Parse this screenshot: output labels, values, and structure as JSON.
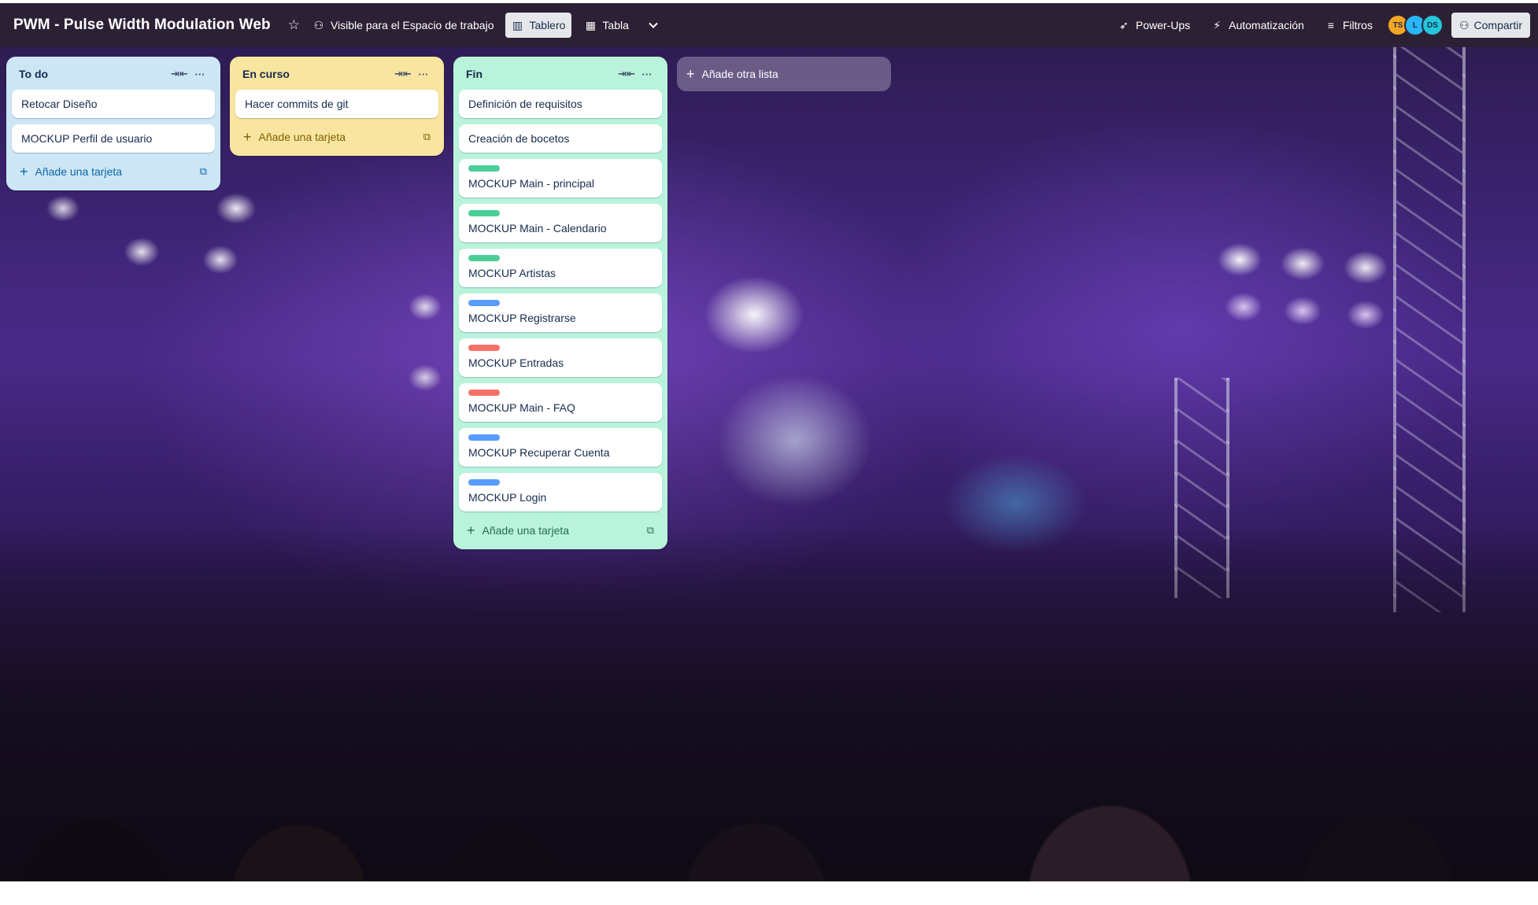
{
  "header": {
    "board_title": "PWM - Pulse Width Modulation Web",
    "visibility_label": "Visible para el Espacio de trabajo",
    "views": [
      {
        "label": "Tablero",
        "active": true
      },
      {
        "label": "Tabla",
        "active": false
      }
    ],
    "power_ups_label": "Power-Ups",
    "automation_label": "Automatización",
    "filters_label": "Filtros",
    "members": [
      {
        "initials": "TS",
        "color": "#f5a623"
      },
      {
        "initials": "L",
        "color": "#29b6f6"
      },
      {
        "initials": "DS",
        "color": "#26c6da"
      }
    ],
    "share_label": "Compartir"
  },
  "lists": [
    {
      "title": "To do",
      "cards": [
        {
          "title": "Retocar Diseño"
        },
        {
          "title": "MOCKUP Perfil de usuario"
        }
      ],
      "add_card_label": "Añade una tarjeta"
    },
    {
      "title": "En curso",
      "cards": [
        {
          "title": "Hacer commits de git"
        }
      ],
      "add_card_label": "Añade una tarjeta"
    },
    {
      "title": "Fin",
      "cards": [
        {
          "title": "Definición de requisitos"
        },
        {
          "title": "Creación de bocetos"
        },
        {
          "title": "MOCKUP Main - principal",
          "label_color": "#4bce97"
        },
        {
          "title": "MOCKUP Main - Calendario",
          "label_color": "#4bce97"
        },
        {
          "title": "MOCKUP Artistas",
          "label_color": "#4bce97"
        },
        {
          "title": "MOCKUP Registrarse",
          "label_color": "#579dff"
        },
        {
          "title": "MOCKUP Entradas",
          "label_color": "#f87168"
        },
        {
          "title": "MOCKUP Main - FAQ",
          "label_color": "#f87168"
        },
        {
          "title": "MOCKUP Recuperar Cuenta",
          "label_color": "#579dff"
        },
        {
          "title": "MOCKUP Login",
          "label_color": "#579dff"
        }
      ],
      "add_card_label": "Añade una tarjeta"
    }
  ],
  "add_list_label": "Añade otra lista"
}
